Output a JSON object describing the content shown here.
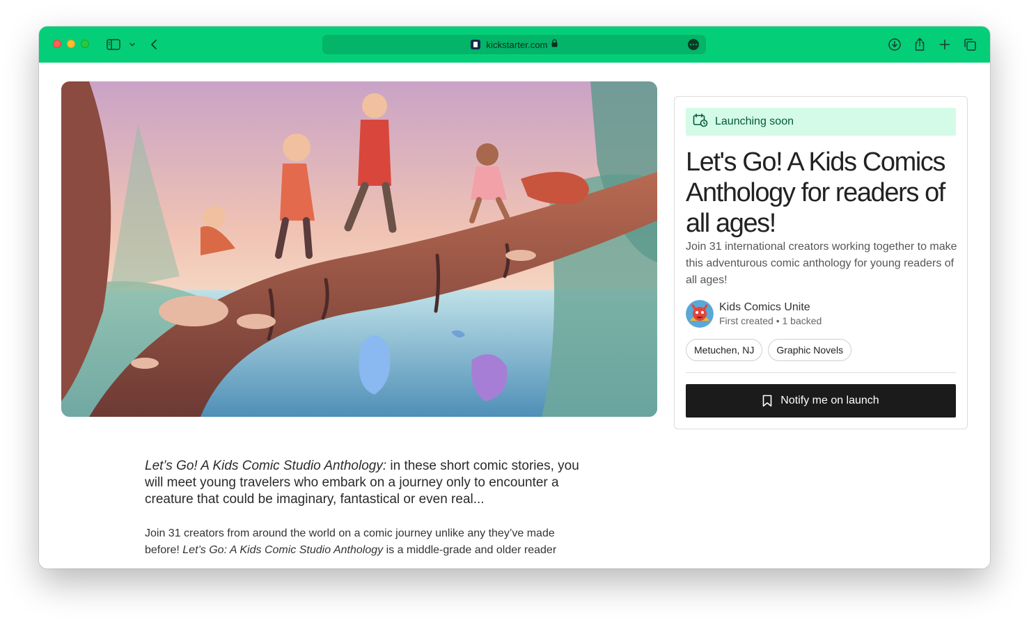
{
  "browser": {
    "url": "kickstarter.com",
    "accent_color": "#05ce78"
  },
  "badge": {
    "label": "Launching soon",
    "icon": "calendar-clock-icon"
  },
  "project": {
    "title": "Let's Go! A Kids Comics Anthology for readers of all ages!",
    "blurb": "Join 31 international creators working together to make this adventurous comic anthology for young readers of all ages!"
  },
  "creator": {
    "name": "Kids Comics Unite",
    "meta": "First created • 1 backed"
  },
  "tags": [
    "Metuchen, NJ",
    "Graphic Novels"
  ],
  "cta": {
    "label": "Notify me on launch",
    "icon": "bookmark-icon"
  },
  "story": {
    "lead_italic": "Let’s Go! A Kids Comic Studio Anthology:",
    "lead_rest": " in these short comic stories, you will meet young travelers who embark on a journey only to encounter a creature that could be imaginary, fantastical or even real...",
    "para_start": "Join 31 creators from around the world on a comic journey unlike any they’ve made before! ",
    "para_italic": "Let’s Go: A Kids Comic Studio Anthology",
    "para_end": " is a middle-grade and older reader"
  }
}
